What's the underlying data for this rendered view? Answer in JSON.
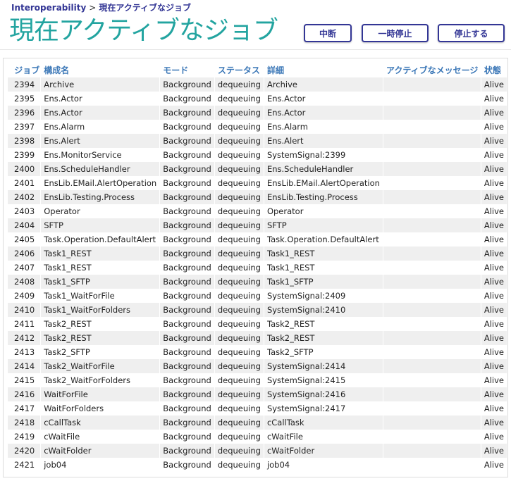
{
  "breadcrumb": {
    "root": "Interoperability",
    "separator": ">",
    "current": "現在アクティブなジョブ"
  },
  "page_title": "現在アクティブなジョブ",
  "buttons": {
    "abort": "中断",
    "suspend": "一時停止",
    "stop": "停止する"
  },
  "table": {
    "headers": [
      "ジョブ",
      "構成名",
      "モード",
      "ステータス",
      "詳細",
      "アクティブなメッセージ",
      "状態"
    ],
    "rows": [
      [
        "2394",
        "Archive",
        "Background",
        "dequeuing",
        "Archive",
        "",
        "Alive"
      ],
      [
        "2395",
        "Ens.Actor",
        "Background",
        "dequeuing",
        "Ens.Actor",
        "",
        "Alive"
      ],
      [
        "2396",
        "Ens.Actor",
        "Background",
        "dequeuing",
        "Ens.Actor",
        "",
        "Alive"
      ],
      [
        "2397",
        "Ens.Alarm",
        "Background",
        "dequeuing",
        "Ens.Alarm",
        "",
        "Alive"
      ],
      [
        "2398",
        "Ens.Alert",
        "Background",
        "dequeuing",
        "Ens.Alert",
        "",
        "Alive"
      ],
      [
        "2399",
        "Ens.MonitorService",
        "Background",
        "dequeuing",
        "SystemSignal:2399",
        "",
        "Alive"
      ],
      [
        "2400",
        "Ens.ScheduleHandler",
        "Background",
        "dequeuing",
        "Ens.ScheduleHandler",
        "",
        "Alive"
      ],
      [
        "2401",
        "EnsLib.EMail.AlertOperation",
        "Background",
        "dequeuing",
        "EnsLib.EMail.AlertOperation",
        "",
        "Alive"
      ],
      [
        "2402",
        "EnsLib.Testing.Process",
        "Background",
        "dequeuing",
        "EnsLib.Testing.Process",
        "",
        "Alive"
      ],
      [
        "2403",
        "Operator",
        "Background",
        "dequeuing",
        "Operator",
        "",
        "Alive"
      ],
      [
        "2404",
        "SFTP",
        "Background",
        "dequeuing",
        "SFTP",
        "",
        "Alive"
      ],
      [
        "2405",
        "Task.Operation.DefaultAlert",
        "Background",
        "dequeuing",
        "Task.Operation.DefaultAlert",
        "",
        "Alive"
      ],
      [
        "2406",
        "Task1_REST",
        "Background",
        "dequeuing",
        "Task1_REST",
        "",
        "Alive"
      ],
      [
        "2407",
        "Task1_REST",
        "Background",
        "dequeuing",
        "Task1_REST",
        "",
        "Alive"
      ],
      [
        "2408",
        "Task1_SFTP",
        "Background",
        "dequeuing",
        "Task1_SFTP",
        "",
        "Alive"
      ],
      [
        "2409",
        "Task1_WaitForFile",
        "Background",
        "dequeuing",
        "SystemSignal:2409",
        "",
        "Alive"
      ],
      [
        "2410",
        "Task1_WaitForFolders",
        "Background",
        "dequeuing",
        "SystemSignal:2410",
        "",
        "Alive"
      ],
      [
        "2411",
        "Task2_REST",
        "Background",
        "dequeuing",
        "Task2_REST",
        "",
        "Alive"
      ],
      [
        "2412",
        "Task2_REST",
        "Background",
        "dequeuing",
        "Task2_REST",
        "",
        "Alive"
      ],
      [
        "2413",
        "Task2_SFTP",
        "Background",
        "dequeuing",
        "Task2_SFTP",
        "",
        "Alive"
      ],
      [
        "2414",
        "Task2_WaitForFile",
        "Background",
        "dequeuing",
        "SystemSignal:2414",
        "",
        "Alive"
      ],
      [
        "2415",
        "Task2_WaitForFolders",
        "Background",
        "dequeuing",
        "SystemSignal:2415",
        "",
        "Alive"
      ],
      [
        "2416",
        "WaitForFile",
        "Background",
        "dequeuing",
        "SystemSignal:2416",
        "",
        "Alive"
      ],
      [
        "2417",
        "WaitForFolders",
        "Background",
        "dequeuing",
        "SystemSignal:2417",
        "",
        "Alive"
      ],
      [
        "2418",
        "cCallTask",
        "Background",
        "dequeuing",
        "cCallTask",
        "",
        "Alive"
      ],
      [
        "2419",
        "cWaitFile",
        "Background",
        "dequeuing",
        "cWaitFile",
        "",
        "Alive"
      ],
      [
        "2420",
        "cWaitFolder",
        "Background",
        "dequeuing",
        "cWaitFolder",
        "",
        "Alive"
      ],
      [
        "2421",
        "job04",
        "Background",
        "dequeuing",
        "job04",
        "",
        "Alive"
      ]
    ]
  }
}
